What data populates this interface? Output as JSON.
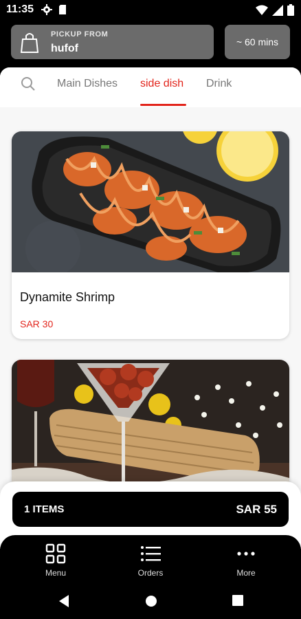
{
  "status_bar": {
    "time": "11:35",
    "icons": [
      "gear-icon",
      "sd-card-icon",
      "wifi-icon",
      "signal-icon",
      "battery-icon"
    ]
  },
  "header": {
    "pickup_label": "PICKUP FROM",
    "pickup_city": "hufof",
    "eta": "~ 60 mins"
  },
  "tabs": {
    "items": [
      {
        "label": "Main Dishes",
        "active": false
      },
      {
        "label": "side dish",
        "active": true
      },
      {
        "label": "Drink",
        "active": false
      }
    ]
  },
  "products": [
    {
      "name": "Dynamite Shrimp",
      "price": "SAR 30"
    },
    {
      "name": "",
      "price": ""
    }
  ],
  "cart": {
    "items_label": "1 ITEMS",
    "total": "SAR 55"
  },
  "bottom_nav": {
    "items": [
      {
        "label": "Menu",
        "icon": "grid-icon"
      },
      {
        "label": "Orders",
        "icon": "list-icon"
      },
      {
        "label": "More",
        "icon": "dots-icon"
      }
    ]
  },
  "colors": {
    "accent": "#e2231a",
    "header_box": "#6b6b6b",
    "background": "#f7f7f7"
  }
}
